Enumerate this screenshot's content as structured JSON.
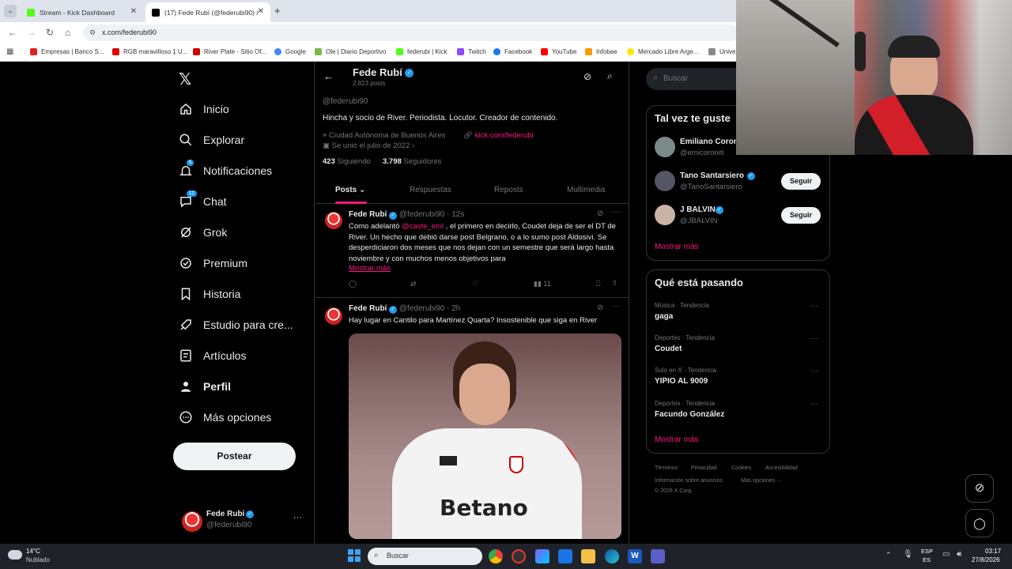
{
  "browser": {
    "tabs": [
      {
        "title": "Stream - Kick Dashboard"
      },
      {
        "title": "(17) Fede Rubí (@federubi90) /"
      }
    ],
    "url": "x.com/federubi90",
    "bookmarks": [
      "Empresas | Banco S...",
      "RGB maravilloso 1 U...",
      "River Plate - Sitio Of...",
      "Google",
      "Ole | Diario Deportivo",
      "federubi | Kick",
      "Twitch",
      "Facebook",
      "YouTube",
      "Infobae",
      "Mercado Libre Arge...",
      "Unive"
    ]
  },
  "nav": {
    "items": [
      {
        "label": "Inicio",
        "icon": "home-icon"
      },
      {
        "label": "Explorar",
        "icon": "search-icon"
      },
      {
        "label": "Notificaciones",
        "icon": "bell-icon",
        "badge": "5"
      },
      {
        "label": "Chat",
        "icon": "chat-icon",
        "badge": "12"
      },
      {
        "label": "Grok",
        "icon": "grok-icon"
      },
      {
        "label": "Premium",
        "icon": "premium-icon"
      },
      {
        "label": "Historia",
        "icon": "bookmark-icon"
      },
      {
        "label": "Estudio para cre...",
        "icon": "rocket-icon"
      },
      {
        "label": "Artículos",
        "icon": "article-icon"
      },
      {
        "label": "Perfil",
        "icon": "person-icon"
      },
      {
        "label": "Más opciones",
        "icon": "more-circle-icon"
      }
    ],
    "post_button": "Postear",
    "account": {
      "name": "Fede Rubí",
      "handle": "@federubi90"
    }
  },
  "profile": {
    "header_name": "Fede Rubí",
    "header_posts": "2.823 posts",
    "handle": "@federubi90",
    "bio": "Hincha y socio de River. Periodista. Locutor. Creador de contenido.",
    "location": "Ciudad Autónoma de Buenos Aires",
    "link": "kick.com/federubi",
    "joined": "Se unió el julio de 2022",
    "following_count": "423",
    "following_label": "Siguiendo",
    "followers_count": "3.798",
    "followers_label": "Seguidores",
    "tabs": [
      "Posts",
      "Respuestas",
      "Reposts",
      "Multimedia"
    ]
  },
  "tweets": [
    {
      "name": "Fede Rubí",
      "handle": "@federubi90",
      "time": "· 12s",
      "text_pre": "Como adelantó ",
      "mention": "@caste_emi",
      "text_post": " , el primero en decirlo, Coudet deja de ser el DT de River. Un hecho que debió darse post Belgrano, o a lo sumo post Aldosivi. Se desperdiciaron dos meses que nos dejan con un semestre que será largo hasta noviembre y con muchos menos objetivos para",
      "show_more": "Mostrar más",
      "views": "11"
    },
    {
      "name": "Fede Rubí",
      "handle": "@federubi90",
      "time": "· 2h",
      "text": "Hay lugar en Cantilo para Martínez Quarta? Insostenible que siga en River",
      "image_text": "Betano"
    }
  ],
  "right": {
    "search_placeholder": "Buscar",
    "suggest_title": "Tal vez te guste",
    "suggestions": [
      {
        "name": "Emiliano Coron",
        "handle": "@emicoroniti"
      },
      {
        "name": "Tano Santarsiero",
        "handle": "@TanoSantarsiero",
        "button": "Seguir"
      },
      {
        "name": "J BALVIN",
        "handle": "@JBALVIN",
        "button": "Seguir"
      }
    ],
    "show_more": "Mostrar más",
    "trends_title": "Qué está pasando",
    "trends": [
      {
        "category": "Música · Tendencia",
        "name": "gaga"
      },
      {
        "category": "Deportes · Tendencia",
        "name": "Coudet"
      },
      {
        "category": "Solo en X · Tendencia",
        "name": "YIPIO AL 9009"
      },
      {
        "category": "Deportes · Tendencia",
        "name": "Facundo González"
      }
    ],
    "trends_more": "Mostrar más",
    "footer": [
      "Términos",
      "Privacidad",
      "Cookies",
      "Accesibilidad",
      "Información sobre anuncios",
      "Más opciones ···",
      "© 2026 X Corp."
    ]
  },
  "taskbar": {
    "weather_temp": "14°C",
    "weather_desc": "Nublado",
    "search": "Buscar",
    "lang": "ESP",
    "lang2": "ES",
    "time": "03:17",
    "date": "27/8/2026"
  },
  "colors": {
    "accent": "#1d9bf0",
    "link": "#f91880",
    "bg": "#000000"
  }
}
